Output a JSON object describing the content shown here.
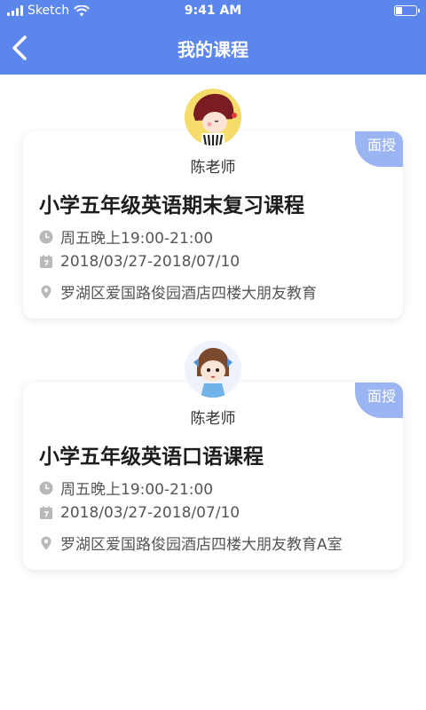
{
  "status_bar": {
    "carrier": "Sketch",
    "time": "9:41 AM"
  },
  "nav": {
    "title": "我的课程",
    "back_icon": "chevron-left-icon"
  },
  "colors": {
    "primary": "#5b86ec",
    "tag": "#9bb4f2",
    "meta_icon": "#b9b9b9"
  },
  "courses": [
    {
      "tag": "面授",
      "teacher": "陈老师",
      "title": "小学五年级英语期末复习课程",
      "time": "周五晚上19:00-21:00",
      "date_range": "2018/03/27-2018/07/10",
      "address": "罗湖区爱国路俊园酒店四楼大朋友教育"
    },
    {
      "tag": "面授",
      "teacher": "陈老师",
      "title": "小学五年级英语口语课程",
      "time": "周五晚上19:00-21:00",
      "date_range": "2018/03/27-2018/07/10",
      "address": "罗湖区爱国路俊园酒店四楼大朋友教育A室"
    }
  ]
}
